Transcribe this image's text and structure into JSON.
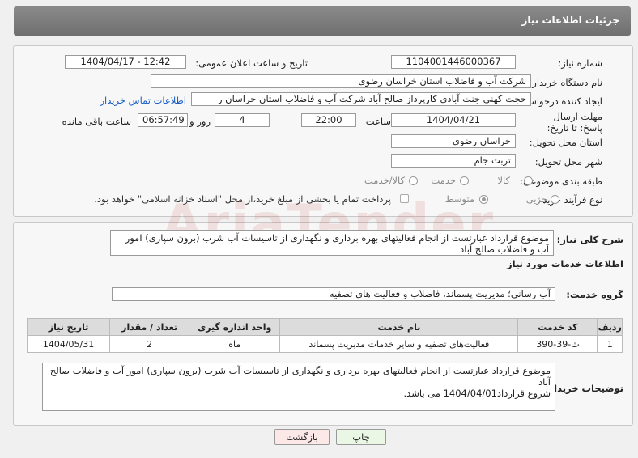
{
  "header": {
    "title": "جزئیات اطلاعات نیاز"
  },
  "form": {
    "need_number_label": "شماره نیاز:",
    "need_number": "1104001446000367",
    "announce_label": "تاریخ و ساعت اعلان عمومی:",
    "announce_value": "1404/04/17 - 12:42",
    "buyer_org_label": "نام دستگاه خریدار:",
    "buyer_org": "شرکت آب و فاضلاب استان خراسان رضوی",
    "creator_label": "ایجاد کننده درخواست:",
    "creator": "حجت کهنی جنت آبادی کارپرداز صالح آباد  شرکت آب و فاضلاب استان خراسان ر",
    "contact_link": "اطلاعات تماس خریدار",
    "deadline_label": "مهلت ارسال پاسخ: تا تاریخ:",
    "deadline_date": "1404/04/21",
    "time_label": "ساعت",
    "deadline_time": "22:00",
    "days": "4",
    "days_label": "روز و",
    "remaining_time": "06:57:49",
    "remaining_label": "ساعت باقی مانده",
    "province_label": "استان محل تحویل:",
    "province": "خراسان رضوی",
    "city_label": "شهر محل تحویل:",
    "city": "تربت جام",
    "category_label": "طبقه بندی موضوعی:",
    "category_options": [
      "کالا",
      "خدمت",
      "کالا/خدمت"
    ],
    "purchase_label": "نوع فرآیند خرید :",
    "purchase_options": [
      "جزیی",
      "متوسط"
    ],
    "payment_note": "پرداخت تمام یا بخشی از مبلغ خرید،از محل \"اسناد خزانه اسلامی\" خواهد بود."
  },
  "summary": {
    "label": "شرح کلی نیاز:",
    "text": "موضوع قرارداد عبارتست از انجام فعالیتهای بهره برداری و نگهداری از تاسیسات آب شرب (برون سپاری) امور آب و فاضلاب صالح آباد"
  },
  "services": {
    "title": "اطلاعات خدمات مورد نیاز",
    "group_label": "گروه خدمت:",
    "group": "آب رسانی؛ مدیریت پسماند، فاضلاب و فعالیت های تصفیه",
    "columns": [
      "ردیف",
      "کد خدمت",
      "نام خدمت",
      "واحد اندازه گیری",
      "تعداد / مقدار",
      "تاریخ نیاز"
    ],
    "rows": [
      {
        "idx": "1",
        "code": "ث-39-390",
        "name": "فعالیت‌های تصفیه و سایر خدمات مدیریت پسماند",
        "unit": "ماه",
        "qty": "2",
        "date": "1404/05/31"
      }
    ]
  },
  "buyer_notes": {
    "label": "توضیحات خریدار:",
    "line1": "موضوع قرارداد عبارتست از انجام فعالیتهای بهره برداری و نگهداری از تاسیسات آب شرب (برون سپاری) امور آب و فاضلاب صالح آباد",
    "line2": "شروع قرارداد1404/04/01 می باشد."
  },
  "buttons": {
    "print": "چاپ",
    "back": "بازگشت"
  },
  "colors": {
    "header": "#777777",
    "back_button": "#fde8e8",
    "print_button": "#eaf7e4",
    "link": "#1a5cc8"
  }
}
